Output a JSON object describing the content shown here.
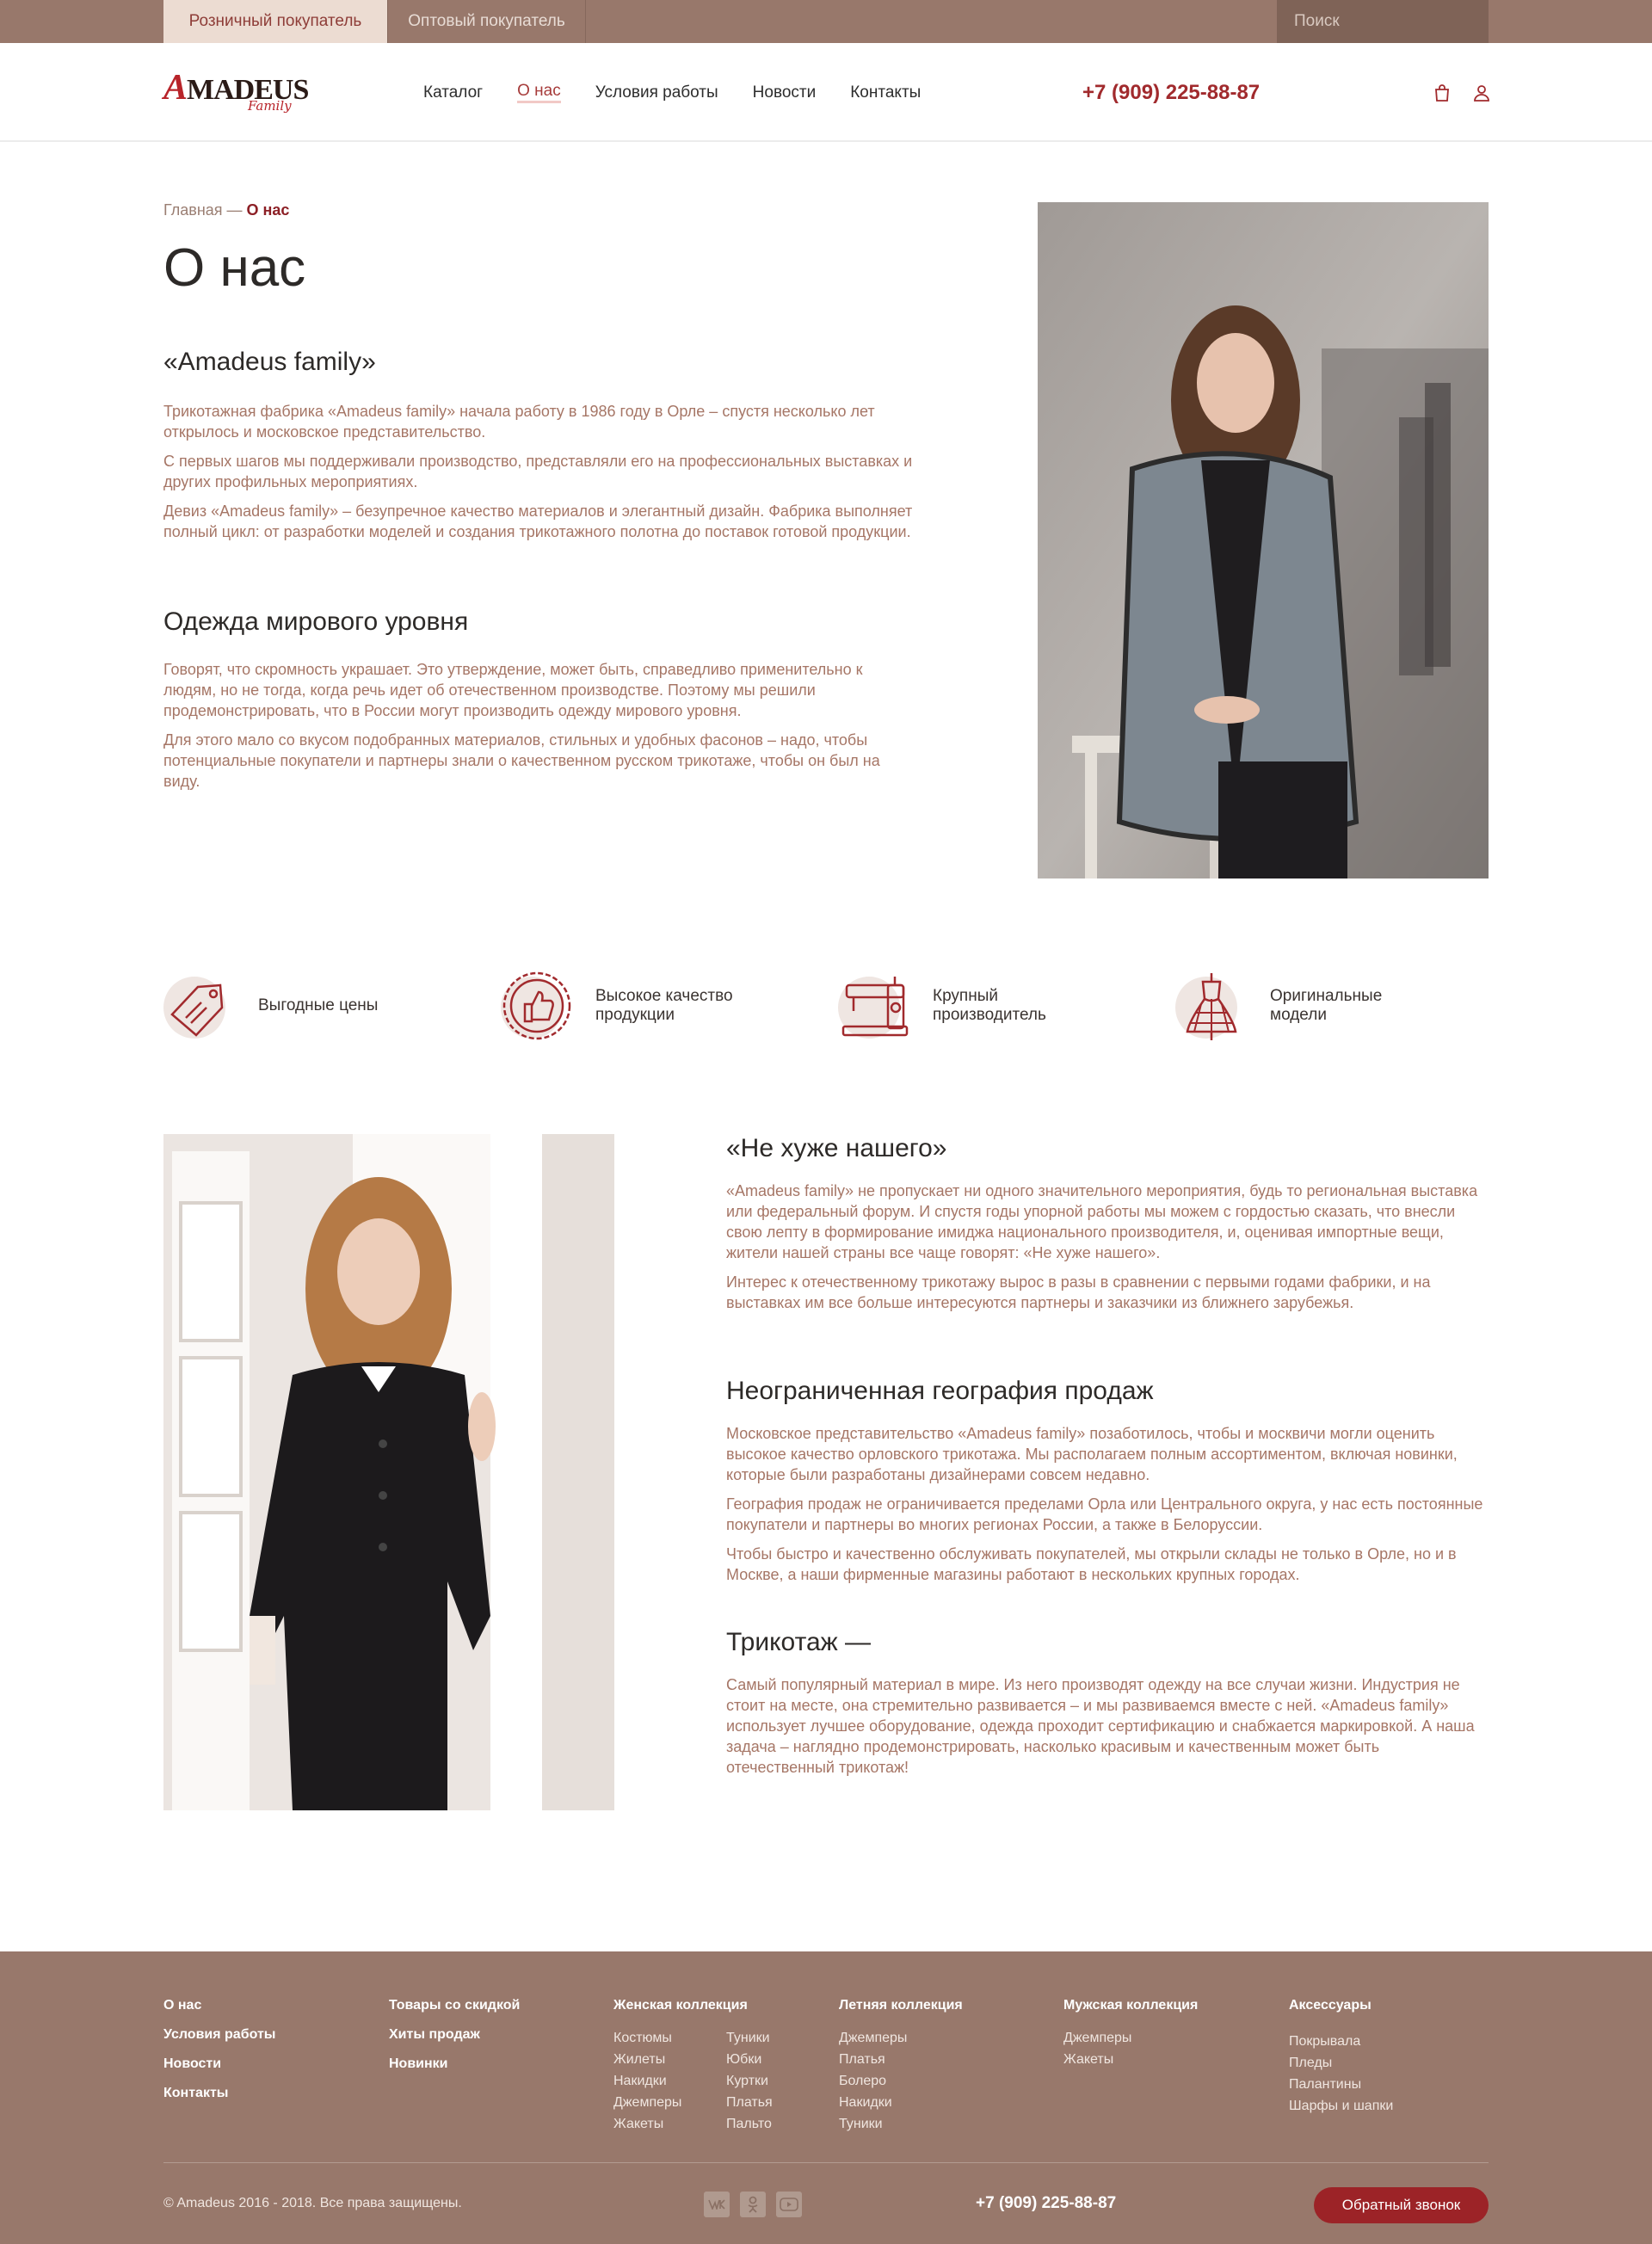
{
  "topbar": {
    "tabs": [
      {
        "label": "Розничный покупатель",
        "active": true
      },
      {
        "label": "Оптовый покупатель",
        "active": false
      }
    ],
    "search_placeholder": "Поиск"
  },
  "header": {
    "logo_brand": "MADEUS",
    "logo_letter": "A",
    "logo_script": "Family",
    "nav": [
      "Каталог",
      "О нас",
      "Условия работы",
      "Новости",
      "Контакты"
    ],
    "nav_active": "О нас",
    "phone": "+7 (909) 225-88-87"
  },
  "breadcrumb": {
    "home": "Главная",
    "separator": " — ",
    "current": "О нас"
  },
  "page_title": "О нас",
  "section1": {
    "title": "«Amadeus family»",
    "paragraphs": [
      "Трикотажная фабрика «Amadeus family» начала работу в 1986 году в Орле – спустя несколько лет открылось и московское представительство.",
      "С первых шагов мы поддерживали производство, представляли его на профессиональных выставках и других профильных мероприятиях.",
      "Девиз «Amadeus family» – безупречное качество материалов и элегантный дизайн. Фабрика выполняет полный цикл: от разработки моделей и создания трикотажного полотна до поставок готовой продукции."
    ]
  },
  "section2": {
    "title": "Одежда мирового уровня",
    "paragraphs": [
      "Говорят, что скромность украшает. Это утверждение, может быть, справедливо применительно к людям, но не тогда, когда речь идет об отечественном производстве. Поэтому мы решили продемонстрировать, что в России могут производить одежду мирового уровня.",
      "Для этого мало со вкусом подобранных материалов, стильных и удобных фасонов – надо, чтобы потенциальные покупатели и партнеры знали о качественном русском трикотаже, чтобы он был на виду."
    ]
  },
  "features": [
    {
      "icon": "price-tag-icon",
      "label": "Выгодные цены"
    },
    {
      "icon": "thumbs-up-badge-icon",
      "label": "Высокое качество продукции"
    },
    {
      "icon": "sewing-machine-icon",
      "label": "Крупный производитель"
    },
    {
      "icon": "dress-mannequin-icon",
      "label": "Оригинальные модели"
    }
  ],
  "section3": {
    "title": "«Не хуже нашего»",
    "paragraphs": [
      "«Amadeus family» не пропускает ни одного значительного мероприятия, будь то региональная выставка или федеральный форум. И спустя годы упорной работы мы можем с гордостью сказать, что внесли свою лепту в формирование имиджа национального производителя, и, оценивая импортные вещи, жители нашей страны все чаще говорят: «Не хуже нашего».",
      "Интерес к отечественному трикотажу вырос в разы в сравнении с первыми годами фабрики, и на выставках им все больше интересуются партнеры и заказчики из ближнего зарубежья."
    ]
  },
  "section4": {
    "title": "Неограниченная география продаж",
    "paragraphs": [
      "Московское представительство «Amadeus family» позаботилось, чтобы и москвичи могли оценить высокое качество орловского трикотажа. Мы располагаем полным ассортиментом, включая новинки, которые были разработаны дизайнерами совсем недавно.",
      "География продаж не ограничивается пределами Орла или Центрального округа, у нас есть постоянные покупатели и партнеры во многих регионах России, а также в Белоруссии.",
      "Чтобы быстро и качественно обслуживать покупателей, мы открыли склады не только в Орле, но и в Москве, а наши фирменные магазины работают в нескольких крупных городах."
    ]
  },
  "section5": {
    "title": "Трикотаж —",
    "paragraphs": [
      "Самый популярный материал в мире. Из него производят одежду на все случаи жизни. Индустрия не стоит на месте, она стремительно развивается – и мы развиваемся вместе с ней. «Amadeus family» использует лучшее оборудование, одежда проходит сертификацию и снабжается маркировкой. А наша задача – наглядно продемонстрировать, насколько красивым и качественным может быть отечественный трикотаж!"
    ]
  },
  "footer": {
    "col1": [
      "О нас",
      "Условия работы",
      "Новости",
      "Контакты"
    ],
    "col2": [
      "Товары со скидкой",
      "Хиты продаж",
      "Новинки"
    ],
    "women": {
      "title": "Женская коллекция",
      "left": [
        "Костюмы",
        "Жилеты",
        "Накидки",
        "Джемперы",
        "Жакеты"
      ],
      "right": [
        "Туники",
        "Юбки",
        "Куртки",
        "Платья",
        "Пальто"
      ]
    },
    "summer": {
      "title": "Летняя коллекция",
      "items": [
        "Джемперы",
        "Платья",
        "Болеро",
        "Накидки",
        "Туники"
      ]
    },
    "men": {
      "title": "Мужская коллекция",
      "items": [
        "Джемперы",
        "Жакеты"
      ]
    },
    "accessories": {
      "title": "Аксессуары",
      "items": [
        "Покрывала",
        "Пледы",
        "Палантины",
        "Шарфы и шапки"
      ]
    },
    "copyright": "© Amadeus 2016 - 2018. Все права защищены.",
    "socials": [
      "vk-icon",
      "odnoklassniki-icon",
      "youtube-icon"
    ],
    "phone": "+7 (909) 225-88-87",
    "callback": "Обратный звонок"
  },
  "colors": {
    "accent": "#a12a2d",
    "brown": "#98786b",
    "text_muted": "#a67666"
  }
}
